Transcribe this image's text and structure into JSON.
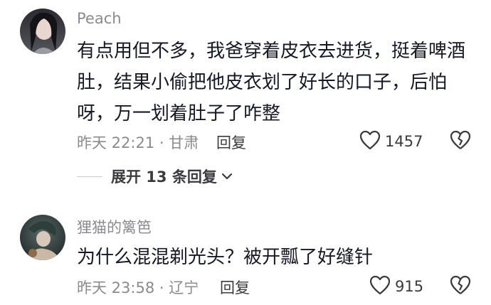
{
  "comments": [
    {
      "username": "Peach",
      "lines": [
        "有点用但不多，我爸穿着皮衣去进货，挺着啤酒",
        "肚，结果小偷把他皮衣划了好长的口子，后怕",
        "呀，万一划着肚子了咋整"
      ],
      "meta": "昨天 22:21 · 甘肃",
      "reply_label": "回复",
      "likes": "1457",
      "expand_label": "展开 13 条回复"
    },
    {
      "username": "狸猫的篱笆",
      "lines": [
        "为什么混混剃光头？被开瓢了好缝针"
      ],
      "meta": "昨天 23:58 · 辽宁",
      "reply_label": "回复",
      "likes": "915"
    }
  ],
  "colors": {
    "muted_text": "#8a8a8f",
    "body_text": "#161823"
  },
  "icons": [
    "heart-outline-icon",
    "broken-heart-icon",
    "chevron-down-icon"
  ]
}
